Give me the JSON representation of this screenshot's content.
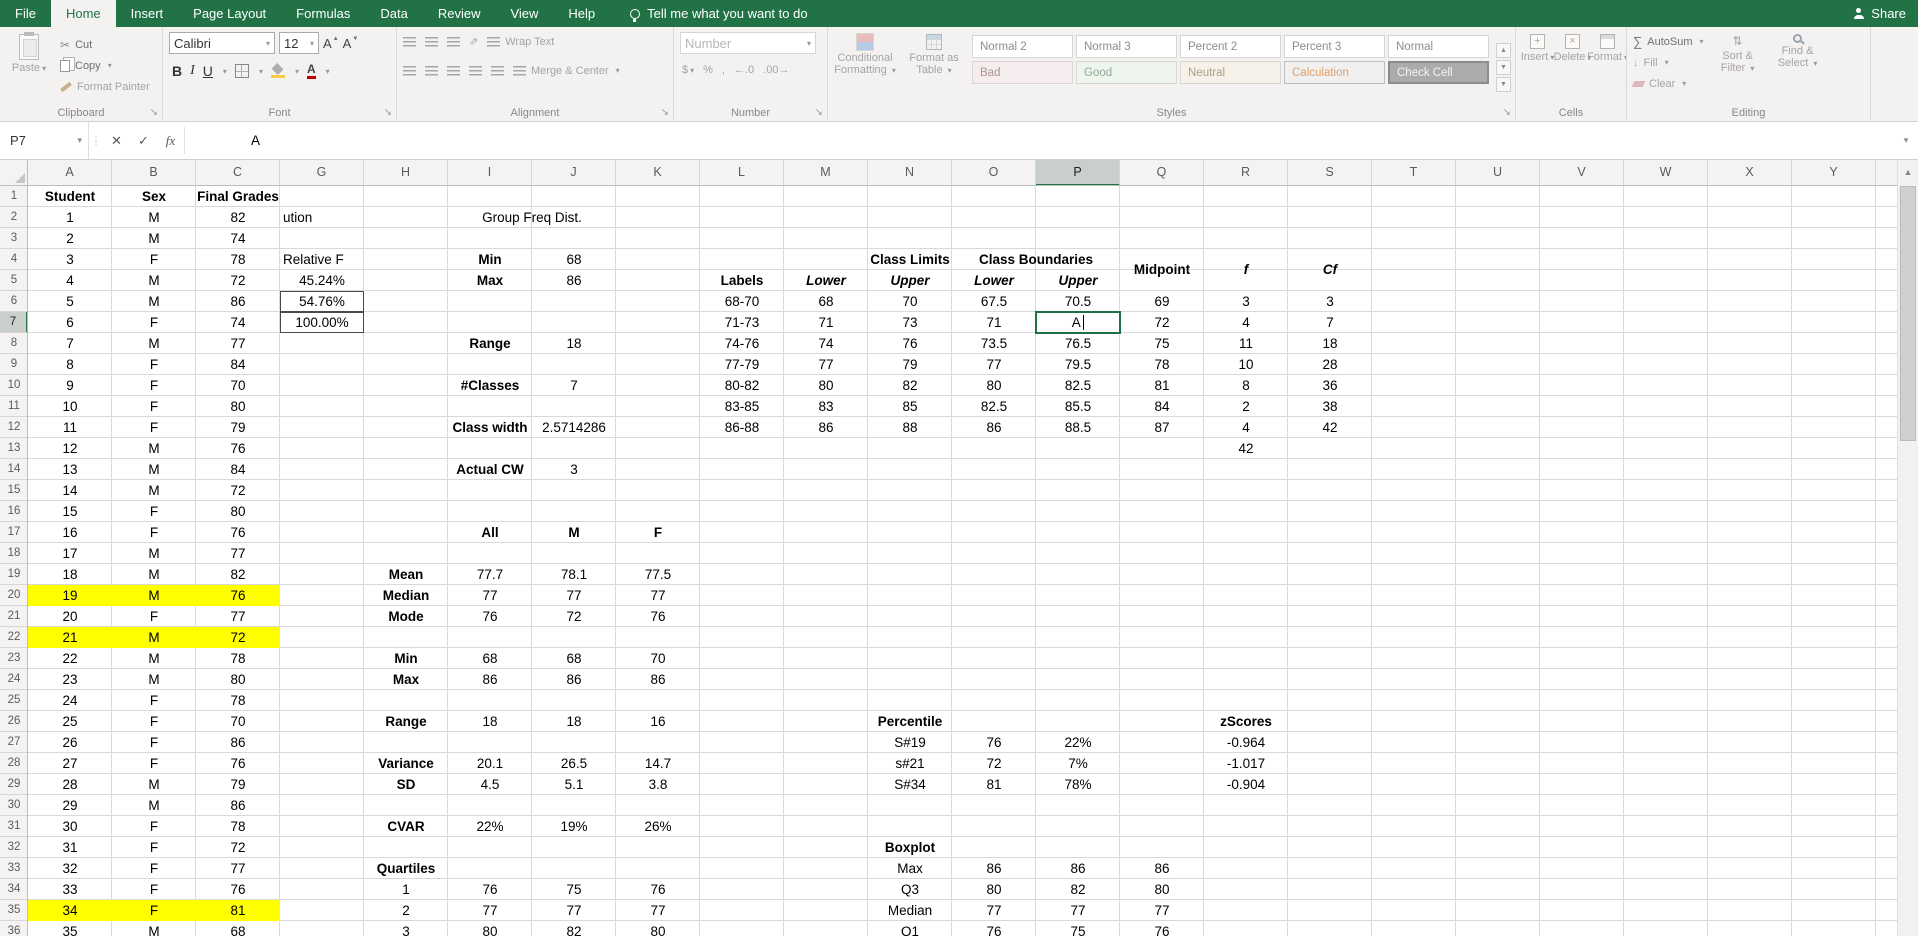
{
  "colors": {
    "accent_green": "#217346",
    "highlight_yellow": "#FFFF00",
    "selection_border": "#1E7145"
  },
  "tabs": {
    "items": [
      "File",
      "Home",
      "Insert",
      "Page Layout",
      "Formulas",
      "Data",
      "Review",
      "View",
      "Help"
    ],
    "active": "Home",
    "tell_me": "Tell me what you want to do",
    "share": "Share"
  },
  "ribbon": {
    "clipboard": {
      "label": "Clipboard",
      "paste": "Paste",
      "cut": "Cut",
      "copy": "Copy",
      "format_painter": "Format Painter"
    },
    "font": {
      "label": "Font",
      "family": "Calibri",
      "size": "12"
    },
    "alignment": {
      "label": "Alignment",
      "wrap_text": "Wrap Text",
      "merge_center": "Merge & Center"
    },
    "number": {
      "label": "Number",
      "format": "Number"
    },
    "styles": {
      "label": "Styles",
      "conditional": "Conditional Formatting",
      "format_table": "Format as Table",
      "gallery_row1": [
        "Normal 2",
        "Normal 3",
        "Percent 2",
        "Percent 3",
        "Normal"
      ],
      "gallery_row2": [
        "Bad",
        "Good",
        "Neutral",
        "Calculation",
        "Check Cell"
      ]
    },
    "cells": {
      "label": "Cells",
      "insert": "Insert",
      "delete": "Delete",
      "format": "Format"
    },
    "editing": {
      "label": "Editing",
      "autosum": "AutoSum",
      "fill": "Fill",
      "clear": "Clear",
      "sort_filter": "Sort & Filter",
      "find_select": "Find & Select"
    }
  },
  "formula_bar": {
    "name_box": "P7",
    "content": "A"
  },
  "grid": {
    "columns": [
      "A",
      "B",
      "C",
      "G",
      "H",
      "I",
      "J",
      "K",
      "L",
      "M",
      "N",
      "O",
      "P",
      "Q",
      "R",
      "S",
      "T",
      "U",
      "V",
      "W",
      "X",
      "Y"
    ],
    "active_column": "P",
    "active_row": 7,
    "active_cell": "P7",
    "row_count": 36,
    "cells": [
      [
        1,
        "A",
        "Student",
        "h"
      ],
      [
        1,
        "B",
        "Sex",
        "h"
      ],
      [
        1,
        "C",
        "Final Grades",
        "h"
      ],
      [
        2,
        "A",
        "1"
      ],
      [
        2,
        "B",
        "M"
      ],
      [
        2,
        "C",
        "82"
      ],
      [
        2,
        "G",
        "ution",
        "cl"
      ],
      [
        2,
        "I",
        "Group Freq Dist.",
        "s2"
      ],
      [
        3,
        "A",
        "2"
      ],
      [
        3,
        "B",
        "M"
      ],
      [
        3,
        "C",
        "74"
      ],
      [
        4,
        "A",
        "3"
      ],
      [
        4,
        "B",
        "F"
      ],
      [
        4,
        "C",
        "78"
      ],
      [
        4,
        "G",
        "Relative F",
        "cl"
      ],
      [
        4,
        "I",
        "Min",
        "b"
      ],
      [
        4,
        "J",
        "68"
      ],
      [
        4,
        "N",
        "Class Limits",
        "b"
      ],
      [
        4,
        "O",
        "Class Boundaries",
        "b s2"
      ],
      [
        4,
        "Q",
        "Midpoint",
        "b r2"
      ],
      [
        4,
        "R",
        "f",
        "bi r2"
      ],
      [
        4,
        "S",
        "Cf",
        "bi r2"
      ],
      [
        5,
        "A",
        "4"
      ],
      [
        5,
        "B",
        "M"
      ],
      [
        5,
        "C",
        "72"
      ],
      [
        5,
        "G",
        "45.24%"
      ],
      [
        5,
        "I",
        "Max",
        "b"
      ],
      [
        5,
        "J",
        "86"
      ],
      [
        5,
        "L",
        "Labels",
        "b"
      ],
      [
        5,
        "M",
        "Lower",
        "bi"
      ],
      [
        5,
        "N",
        "Upper",
        "bi"
      ],
      [
        5,
        "O",
        "Lower",
        "bi"
      ],
      [
        5,
        "P",
        "Upper",
        "bi"
      ],
      [
        6,
        "A",
        "5"
      ],
      [
        6,
        "B",
        "M"
      ],
      [
        6,
        "C",
        "86"
      ],
      [
        6,
        "G",
        "54.76%",
        "pb"
      ],
      [
        6,
        "L",
        "68-70"
      ],
      [
        6,
        "M",
        "68"
      ],
      [
        6,
        "N",
        "70"
      ],
      [
        6,
        "O",
        "67.5"
      ],
      [
        6,
        "P",
        "70.5"
      ],
      [
        6,
        "Q",
        "69"
      ],
      [
        6,
        "R",
        "3"
      ],
      [
        6,
        "S",
        "3"
      ],
      [
        7,
        "A",
        "6"
      ],
      [
        7,
        "B",
        "F"
      ],
      [
        7,
        "C",
        "74"
      ],
      [
        7,
        "G",
        "100.00%",
        "pb"
      ],
      [
        7,
        "L",
        "71-73"
      ],
      [
        7,
        "M",
        "71"
      ],
      [
        7,
        "N",
        "73"
      ],
      [
        7,
        "O",
        "71"
      ],
      [
        7,
        "P",
        "A",
        "act"
      ],
      [
        7,
        "Q",
        "72"
      ],
      [
        7,
        "R",
        "4"
      ],
      [
        7,
        "S",
        "7"
      ],
      [
        8,
        "A",
        "7"
      ],
      [
        8,
        "B",
        "M"
      ],
      [
        8,
        "C",
        "77"
      ],
      [
        8,
        "I",
        "Range",
        "b"
      ],
      [
        8,
        "J",
        "18"
      ],
      [
        8,
        "L",
        "74-76"
      ],
      [
        8,
        "M",
        "74"
      ],
      [
        8,
        "N",
        "76"
      ],
      [
        8,
        "O",
        "73.5"
      ],
      [
        8,
        "P",
        "76.5"
      ],
      [
        8,
        "Q",
        "75"
      ],
      [
        8,
        "R",
        "11"
      ],
      [
        8,
        "S",
        "18"
      ],
      [
        9,
        "A",
        "8"
      ],
      [
        9,
        "B",
        "F"
      ],
      [
        9,
        "C",
        "84"
      ],
      [
        9,
        "L",
        "77-79"
      ],
      [
        9,
        "M",
        "77"
      ],
      [
        9,
        "N",
        "79"
      ],
      [
        9,
        "O",
        "77"
      ],
      [
        9,
        "P",
        "79.5"
      ],
      [
        9,
        "Q",
        "78"
      ],
      [
        9,
        "R",
        "10"
      ],
      [
        9,
        "S",
        "28"
      ],
      [
        10,
        "A",
        "9"
      ],
      [
        10,
        "B",
        "F"
      ],
      [
        10,
        "C",
        "70"
      ],
      [
        10,
        "I",
        "#Classes",
        "b"
      ],
      [
        10,
        "J",
        "7"
      ],
      [
        10,
        "L",
        "80-82"
      ],
      [
        10,
        "M",
        "80"
      ],
      [
        10,
        "N",
        "82"
      ],
      [
        10,
        "O",
        "80"
      ],
      [
        10,
        "P",
        "82.5"
      ],
      [
        10,
        "Q",
        "81"
      ],
      [
        10,
        "R",
        "8"
      ],
      [
        10,
        "S",
        "36"
      ],
      [
        11,
        "A",
        "10"
      ],
      [
        11,
        "B",
        "F"
      ],
      [
        11,
        "C",
        "80"
      ],
      [
        11,
        "L",
        "83-85"
      ],
      [
        11,
        "M",
        "83"
      ],
      [
        11,
        "N",
        "85"
      ],
      [
        11,
        "O",
        "82.5"
      ],
      [
        11,
        "P",
        "85.5"
      ],
      [
        11,
        "Q",
        "84"
      ],
      [
        11,
        "R",
        "2"
      ],
      [
        11,
        "S",
        "38"
      ],
      [
        12,
        "A",
        "11"
      ],
      [
        12,
        "B",
        "F"
      ],
      [
        12,
        "C",
        "79"
      ],
      [
        12,
        "I",
        "Class width",
        "b"
      ],
      [
        12,
        "J",
        "2.5714286"
      ],
      [
        12,
        "L",
        "86-88"
      ],
      [
        12,
        "M",
        "86"
      ],
      [
        12,
        "N",
        "88"
      ],
      [
        12,
        "O",
        "86"
      ],
      [
        12,
        "P",
        "88.5"
      ],
      [
        12,
        "Q",
        "87"
      ],
      [
        12,
        "R",
        "4"
      ],
      [
        12,
        "S",
        "42"
      ],
      [
        13,
        "A",
        "12"
      ],
      [
        13,
        "B",
        "M"
      ],
      [
        13,
        "C",
        "76"
      ],
      [
        13,
        "R",
        "42"
      ],
      [
        14,
        "A",
        "13"
      ],
      [
        14,
        "B",
        "M"
      ],
      [
        14,
        "C",
        "84"
      ],
      [
        14,
        "I",
        "Actual CW",
        "b"
      ],
      [
        14,
        "J",
        "3"
      ],
      [
        15,
        "A",
        "14"
      ],
      [
        15,
        "B",
        "M"
      ],
      [
        15,
        "C",
        "72"
      ],
      [
        16,
        "A",
        "15"
      ],
      [
        16,
        "B",
        "F"
      ],
      [
        16,
        "C",
        "80"
      ],
      [
        17,
        "A",
        "16"
      ],
      [
        17,
        "B",
        "F"
      ],
      [
        17,
        "C",
        "76"
      ],
      [
        17,
        "I",
        "All",
        "b"
      ],
      [
        17,
        "J",
        "M",
        "b"
      ],
      [
        17,
        "K",
        "F",
        "b"
      ],
      [
        18,
        "A",
        "17"
      ],
      [
        18,
        "B",
        "M"
      ],
      [
        18,
        "C",
        "77"
      ],
      [
        19,
        "A",
        "18"
      ],
      [
        19,
        "B",
        "M"
      ],
      [
        19,
        "C",
        "82"
      ],
      [
        19,
        "H",
        "Mean",
        "b"
      ],
      [
        19,
        "I",
        "77.7"
      ],
      [
        19,
        "J",
        "78.1"
      ],
      [
        19,
        "K",
        "77.5"
      ],
      [
        20,
        "A",
        "19",
        "y"
      ],
      [
        20,
        "B",
        "M",
        "y"
      ],
      [
        20,
        "C",
        "76",
        "y"
      ],
      [
        20,
        "H",
        "Median",
        "b"
      ],
      [
        20,
        "I",
        "77"
      ],
      [
        20,
        "J",
        "77"
      ],
      [
        20,
        "K",
        "77"
      ],
      [
        21,
        "A",
        "20"
      ],
      [
        21,
        "B",
        "F"
      ],
      [
        21,
        "C",
        "77"
      ],
      [
        21,
        "H",
        "Mode",
        "b"
      ],
      [
        21,
        "I",
        "76"
      ],
      [
        21,
        "J",
        "72"
      ],
      [
        21,
        "K",
        "76"
      ],
      [
        22,
        "A",
        "21",
        "y"
      ],
      [
        22,
        "B",
        "M",
        "y"
      ],
      [
        22,
        "C",
        "72",
        "y"
      ],
      [
        23,
        "A",
        "22"
      ],
      [
        23,
        "B",
        "M"
      ],
      [
        23,
        "C",
        "78"
      ],
      [
        23,
        "H",
        "Min",
        "b"
      ],
      [
        23,
        "I",
        "68"
      ],
      [
        23,
        "J",
        "68"
      ],
      [
        23,
        "K",
        "70"
      ],
      [
        24,
        "A",
        "23"
      ],
      [
        24,
        "B",
        "M"
      ],
      [
        24,
        "C",
        "80"
      ],
      [
        24,
        "H",
        "Max",
        "b"
      ],
      [
        24,
        "I",
        "86"
      ],
      [
        24,
        "J",
        "86"
      ],
      [
        24,
        "K",
        "86"
      ],
      [
        25,
        "A",
        "24"
      ],
      [
        25,
        "B",
        "F"
      ],
      [
        25,
        "C",
        "78"
      ],
      [
        26,
        "A",
        "25"
      ],
      [
        26,
        "B",
        "F"
      ],
      [
        26,
        "C",
        "70"
      ],
      [
        26,
        "H",
        "Range",
        "b"
      ],
      [
        26,
        "I",
        "18"
      ],
      [
        26,
        "J",
        "18"
      ],
      [
        26,
        "K",
        "16"
      ],
      [
        26,
        "N",
        "Percentile",
        "b"
      ],
      [
        26,
        "R",
        "zScores",
        "b"
      ],
      [
        27,
        "A",
        "26"
      ],
      [
        27,
        "B",
        "F"
      ],
      [
        27,
        "C",
        "86"
      ],
      [
        27,
        "N",
        "S#19"
      ],
      [
        27,
        "O",
        "76"
      ],
      [
        27,
        "P",
        "22%"
      ],
      [
        27,
        "R",
        "-0.964"
      ],
      [
        28,
        "A",
        "27"
      ],
      [
        28,
        "B",
        "F"
      ],
      [
        28,
        "C",
        "76"
      ],
      [
        28,
        "H",
        "Variance",
        "b"
      ],
      [
        28,
        "I",
        "20.1"
      ],
      [
        28,
        "J",
        "26.5"
      ],
      [
        28,
        "K",
        "14.7"
      ],
      [
        28,
        "N",
        "s#21"
      ],
      [
        28,
        "O",
        "72"
      ],
      [
        28,
        "P",
        "7%"
      ],
      [
        28,
        "R",
        "-1.017"
      ],
      [
        29,
        "A",
        "28"
      ],
      [
        29,
        "B",
        "M"
      ],
      [
        29,
        "C",
        "79"
      ],
      [
        29,
        "H",
        "SD",
        "b"
      ],
      [
        29,
        "I",
        "4.5"
      ],
      [
        29,
        "J",
        "5.1"
      ],
      [
        29,
        "K",
        "3.8"
      ],
      [
        29,
        "N",
        "S#34"
      ],
      [
        29,
        "O",
        "81"
      ],
      [
        29,
        "P",
        "78%"
      ],
      [
        29,
        "R",
        "-0.904"
      ],
      [
        30,
        "A",
        "29"
      ],
      [
        30,
        "B",
        "M"
      ],
      [
        30,
        "C",
        "86"
      ],
      [
        31,
        "A",
        "30"
      ],
      [
        31,
        "B",
        "F"
      ],
      [
        31,
        "C",
        "78"
      ],
      [
        31,
        "H",
        "CVAR",
        "b"
      ],
      [
        31,
        "I",
        "22%"
      ],
      [
        31,
        "J",
        "19%"
      ],
      [
        31,
        "K",
        "26%"
      ],
      [
        32,
        "A",
        "31"
      ],
      [
        32,
        "B",
        "F"
      ],
      [
        32,
        "C",
        "72"
      ],
      [
        32,
        "N",
        "Boxplot",
        "b"
      ],
      [
        33,
        "A",
        "32"
      ],
      [
        33,
        "B",
        "F"
      ],
      [
        33,
        "C",
        "77"
      ],
      [
        33,
        "H",
        "Quartiles",
        "b"
      ],
      [
        33,
        "N",
        "Max"
      ],
      [
        33,
        "O",
        "86"
      ],
      [
        33,
        "P",
        "86"
      ],
      [
        33,
        "Q",
        "86"
      ],
      [
        34,
        "A",
        "33"
      ],
      [
        34,
        "B",
        "F"
      ],
      [
        34,
        "C",
        "76"
      ],
      [
        34,
        "H",
        "1"
      ],
      [
        34,
        "I",
        "76"
      ],
      [
        34,
        "J",
        "75"
      ],
      [
        34,
        "K",
        "76"
      ],
      [
        34,
        "N",
        "Q3"
      ],
      [
        34,
        "O",
        "80"
      ],
      [
        34,
        "P",
        "82"
      ],
      [
        34,
        "Q",
        "80"
      ],
      [
        35,
        "A",
        "34",
        "y"
      ],
      [
        35,
        "B",
        "F",
        "y"
      ],
      [
        35,
        "C",
        "81",
        "y"
      ],
      [
        35,
        "H",
        "2"
      ],
      [
        35,
        "I",
        "77"
      ],
      [
        35,
        "J",
        "77"
      ],
      [
        35,
        "K",
        "77"
      ],
      [
        35,
        "N",
        "Median"
      ],
      [
        35,
        "O",
        "77"
      ],
      [
        35,
        "P",
        "77"
      ],
      [
        35,
        "Q",
        "77"
      ],
      [
        36,
        "A",
        "35"
      ],
      [
        36,
        "B",
        "M"
      ],
      [
        36,
        "C",
        "68"
      ],
      [
        36,
        "H",
        "3"
      ],
      [
        36,
        "I",
        "80"
      ],
      [
        36,
        "J",
        "82"
      ],
      [
        36,
        "K",
        "80"
      ],
      [
        36,
        "N",
        "Q1"
      ],
      [
        36,
        "O",
        "76"
      ],
      [
        36,
        "P",
        "75"
      ],
      [
        36,
        "Q",
        "76"
      ]
    ]
  }
}
